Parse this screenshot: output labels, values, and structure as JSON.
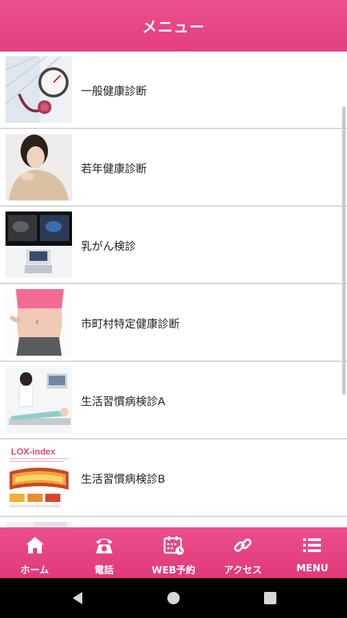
{
  "header": {
    "title": "メニュー"
  },
  "menu_items": [
    {
      "label": "一般健康診断"
    },
    {
      "label": "若年健康診断"
    },
    {
      "label": "乳がん検診"
    },
    {
      "label": "市町村特定健康診断"
    },
    {
      "label": "生活習慣病検診A"
    },
    {
      "label": "生活習慣病検診B"
    }
  ],
  "thumb_text": {
    "lox": "LOX-index"
  },
  "tabbar": {
    "items": [
      {
        "label": "ホーム",
        "icon": "home-icon"
      },
      {
        "label": "電話",
        "icon": "phone-icon"
      },
      {
        "label": "WEB予約",
        "icon": "calendar-icon"
      },
      {
        "label": "アクセス",
        "icon": "link-icon"
      },
      {
        "label": "MENU",
        "icon": "list-icon"
      }
    ]
  },
  "colors": {
    "accent": "#e8467f",
    "divider": "#d6d6d6"
  }
}
